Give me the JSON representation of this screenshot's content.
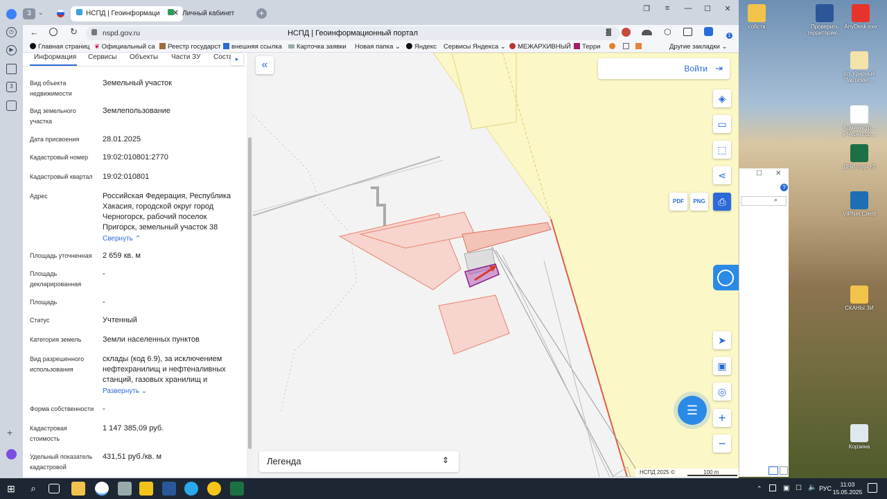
{
  "browser": {
    "tab_count": "3",
    "tabs": [
      {
        "label": "НСПД | Геоинформаци"
      },
      {
        "label": "Личный кабинет"
      }
    ],
    "url": "nspd.gov.ru",
    "page_title": "НСПД | Геоинформационный портал",
    "bookmarks": [
      "Главная страниц",
      "Официальный са",
      "Реестр государст",
      "внешняя ссылка",
      "Карточка заявки",
      "Новая папка",
      "Яндекс",
      "Сервисы Яндекса",
      "МЕЖАРХИВНЫЙ",
      "Терри"
    ],
    "other_bookmarks": "Другие закладки",
    "ext_badge": "1",
    "left_badge": "3"
  },
  "panel": {
    "tabs": [
      "Информация",
      "Сервисы",
      "Объекты",
      "Части ЗУ",
      "Соста"
    ],
    "fields": [
      {
        "label": "Вид объекта недвижимости",
        "value": "Земельный участок"
      },
      {
        "label": "Вид земельного участка",
        "value": "Землепользование"
      },
      {
        "label": "Дата присвоения",
        "value": "28.01.2025"
      },
      {
        "label": "Кадастровый номер",
        "value": "19:02:010801:2770"
      },
      {
        "label": "Кадастровый квартал",
        "value": "19:02:010801"
      },
      {
        "label": "Адрес",
        "value": "Российская Федерация, Республика Хакасия, городской округ город Черногорск, рабочий поселок Пригорск, земельный участок 38"
      },
      {
        "label": "Площадь уточненная",
        "value": "2 659 кв. м"
      },
      {
        "label": "Площадь декларированная",
        "value": "-"
      },
      {
        "label": "Площадь",
        "value": "-"
      },
      {
        "label": "Статус",
        "value": "Учтенный"
      },
      {
        "label": "Категория земель",
        "value": "Земли населенных пунктов"
      },
      {
        "label": "Вид разрешенного использования",
        "value": "склады (код 6.9), за исключением нефтехранилищ и нефтеналивных станций, газовых хранилищ и"
      },
      {
        "label": "Форма собственности",
        "value": "-"
      },
      {
        "label": "Кадастровая стоимость",
        "value": "1 147 385,09 руб."
      },
      {
        "label": "Удельный показатель кадастровой",
        "value": "431,51 руб./кв. м"
      }
    ],
    "collapse_link": "Свернуть",
    "expand_link": "Развернуть"
  },
  "map": {
    "login_label": "Войти",
    "legend_label": "Легенда",
    "copyright": "НСПД 2025 ©",
    "scale": "100 m",
    "pdf_label": "PDF",
    "png_label": "PNG"
  },
  "desktop": {
    "icons": [
      "собств",
      "Проверить территорию...",
      "AnyDesk.exe",
      "ул. Красных Партизан ...",
      "Администр... к Черногор...",
      "ДНИ годы.r3",
      "VIPNet Client",
      "СКАНЫ ЗИ",
      "Корзина"
    ]
  },
  "taskbar": {
    "lang": "РУС",
    "time": "11:03",
    "date": "15.05.2025"
  }
}
